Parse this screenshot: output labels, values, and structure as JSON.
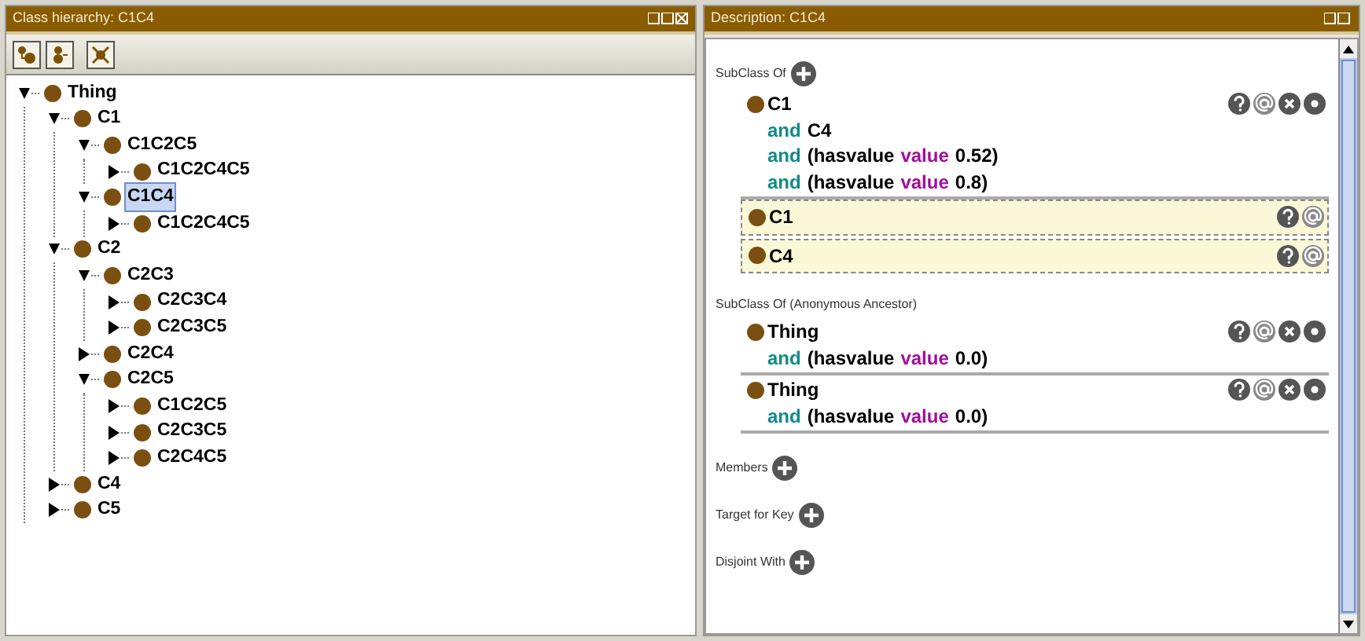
{
  "hierarchy": {
    "title": "Class hierarchy: C1C4",
    "tree": [
      {
        "label": "Thing",
        "expanded": true,
        "selected": false,
        "children": [
          {
            "label": "C1",
            "expanded": true,
            "selected": false,
            "children": [
              {
                "label": "C1C2C5",
                "expanded": true,
                "selected": false,
                "children": [
                  {
                    "label": "C1C2C4C5",
                    "expanded": false,
                    "selected": false
                  }
                ]
              },
              {
                "label": "C1C4",
                "expanded": true,
                "selected": true,
                "children": [
                  {
                    "label": "C1C2C4C5",
                    "expanded": false,
                    "selected": false
                  }
                ]
              }
            ]
          },
          {
            "label": "C2",
            "expanded": true,
            "selected": false,
            "children": [
              {
                "label": "C2C3",
                "expanded": true,
                "selected": false,
                "children": [
                  {
                    "label": "C2C3C4",
                    "expanded": false,
                    "selected": false
                  },
                  {
                    "label": "C2C3C5",
                    "expanded": false,
                    "selected": false
                  }
                ]
              },
              {
                "label": "C2C4",
                "expanded": false,
                "selected": false
              },
              {
                "label": "C2C5",
                "expanded": true,
                "selected": false,
                "children": [
                  {
                    "label": "C1C2C5",
                    "expanded": false,
                    "selected": false
                  },
                  {
                    "label": "C2C3C5",
                    "expanded": false,
                    "selected": false
                  },
                  {
                    "label": "C2C4C5",
                    "expanded": false,
                    "selected": false
                  }
                ]
              }
            ]
          },
          {
            "label": "C4",
            "expanded": false,
            "selected": false
          },
          {
            "label": "C5",
            "expanded": false,
            "selected": false
          }
        ]
      }
    ]
  },
  "description": {
    "title": "Description: C1C4",
    "sections": [
      {
        "header": "SubClass Of",
        "add": true,
        "items": [
          {
            "kind": "asserted",
            "class": "C1",
            "lines": [
              [
                {
                  "kind": "keyword",
                  "text": "and"
                },
                {
                  "kind": "class",
                  "text": "C4"
                }
              ],
              [
                {
                  "kind": "keyword",
                  "text": "and"
                },
                {
                  "kind": "class",
                  "text": "(hasvalue"
                },
                {
                  "kind": "property",
                  "text": "value"
                },
                {
                  "kind": "class",
                  "text": "0.52)"
                }
              ],
              [
                {
                  "kind": "keyword",
                  "text": "and"
                },
                {
                  "kind": "class",
                  "text": "(hasvalue"
                },
                {
                  "kind": "property",
                  "text": "value"
                },
                {
                  "kind": "class",
                  "text": "0.8)"
                }
              ]
            ]
          },
          {
            "kind": "inferred",
            "class": "C1"
          },
          {
            "kind": "inferred",
            "class": "C4"
          }
        ]
      },
      {
        "header": "SubClass Of (Anonymous Ancestor)",
        "add": false,
        "items": [
          {
            "kind": "asserted",
            "class": "Thing",
            "lines": [
              [
                {
                  "kind": "keyword",
                  "text": "and"
                },
                {
                  "kind": "class",
                  "text": "(hasvalue"
                },
                {
                  "kind": "property",
                  "text": "value"
                },
                {
                  "kind": "class",
                  "text": "0.0)"
                }
              ]
            ]
          },
          {
            "kind": "asserted",
            "class": "Thing",
            "lines": [
              [
                {
                  "kind": "keyword",
                  "text": "and"
                },
                {
                  "kind": "class",
                  "text": "(hasvalue"
                },
                {
                  "kind": "property",
                  "text": "value"
                },
                {
                  "kind": "class",
                  "text": "0.0)"
                }
              ]
            ]
          }
        ]
      },
      {
        "header": "Members",
        "add": true
      },
      {
        "header": "Target for Key",
        "add": true
      },
      {
        "header": "Disjoint With",
        "add": true
      }
    ]
  }
}
